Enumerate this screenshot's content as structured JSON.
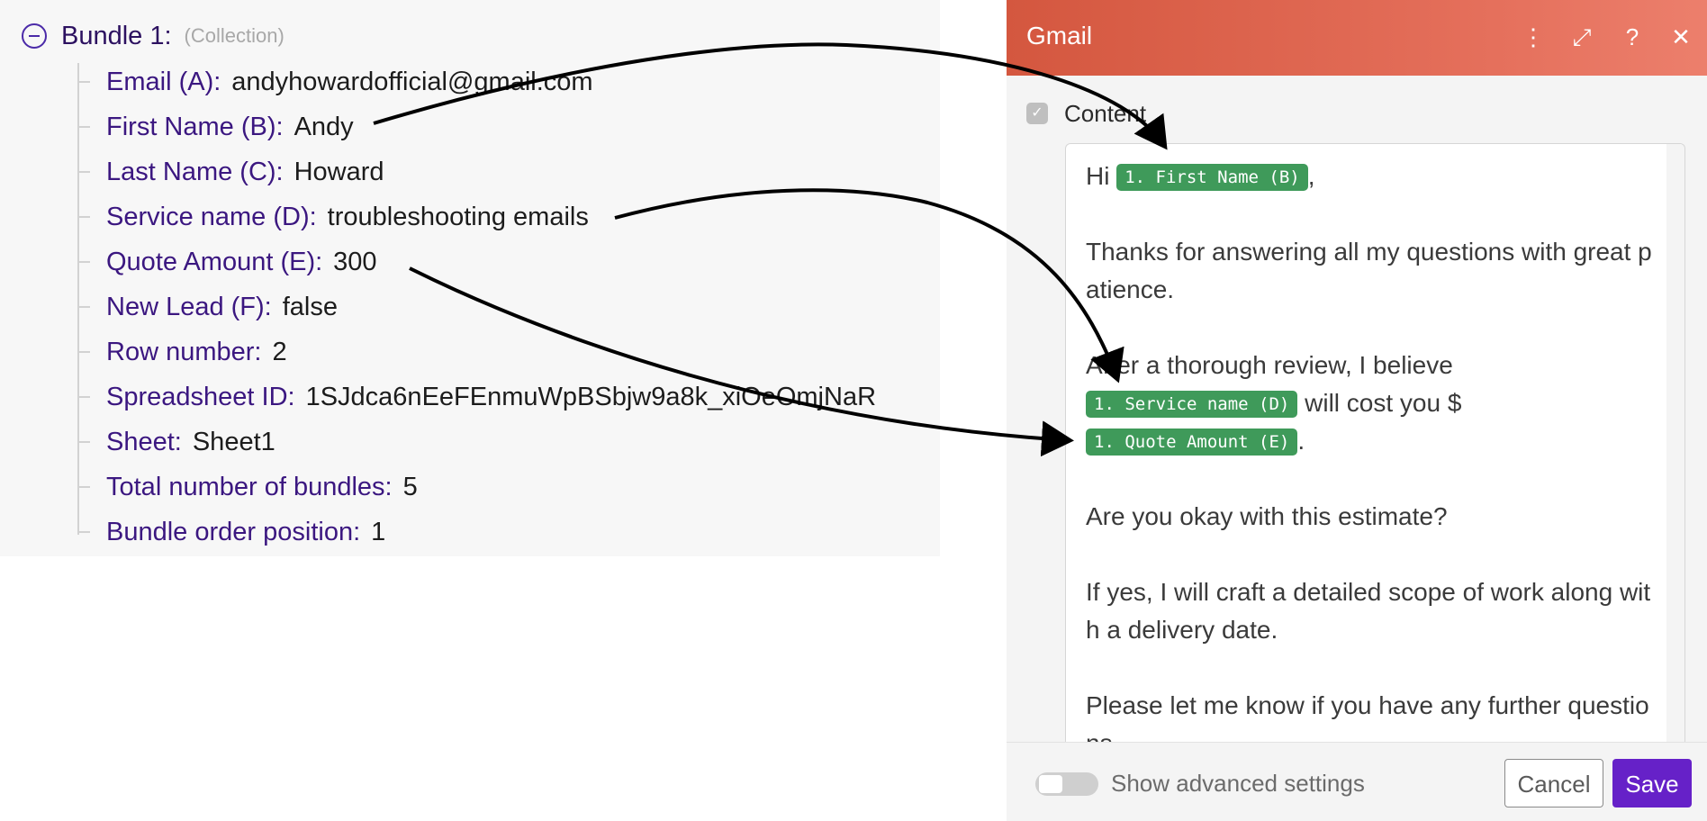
{
  "bundle": {
    "title": "Bundle 1:",
    "type": "(Collection)",
    "fields": [
      {
        "label": "Email (A):",
        "value": "andyhowardofficial@gmail.com"
      },
      {
        "label": "First Name (B):",
        "value": "Andy"
      },
      {
        "label": "Last Name (C):",
        "value": "Howard"
      },
      {
        "label": "Service name (D):",
        "value": "troubleshooting emails"
      },
      {
        "label": "Quote Amount (E):",
        "value": "300"
      },
      {
        "label": "New Lead (F):",
        "value": "false"
      },
      {
        "label": "Row number:",
        "value": "2"
      },
      {
        "label": "Spreadsheet ID:",
        "value": "1SJdca6nEeFEnmuWpBSbjw9a8k_xiOeOmjNaR"
      },
      {
        "label": "Sheet:",
        "value": "Sheet1"
      },
      {
        "label": "Total number of bundles:",
        "value": "5"
      },
      {
        "label": "Bundle order position:",
        "value": "1"
      }
    ]
  },
  "gmail": {
    "title": "Gmail",
    "icons": [
      "more-vertical-icon",
      "expand-icon",
      "help-icon",
      "close-icon"
    ],
    "icon_glyphs": {
      "more": "⋮",
      "expand": "⤢",
      "help": "?",
      "close": "✕"
    },
    "content_label": "Content",
    "check_glyph": "✓",
    "email": {
      "greeting": "Hi",
      "pill_first_name": "1. First Name (B)",
      "comma": ",",
      "line_thanks": "Thanks for answering all my questions with great patience.",
      "line_review": "After a thorough review, I believe",
      "pill_service": "1. Service name (D)",
      "line_cost": "will cost you $",
      "pill_quote": "1. Quote Amount (E)",
      "period": ".",
      "line_okay": "Are you okay with this estimate?",
      "line_scope": "If yes, I will craft a detailed scope of work along with a delivery date.",
      "line_further": "Please let me know if you have any further questions."
    },
    "footer": {
      "advanced_label": "Show advanced settings",
      "advanced_on": false,
      "cancel_label": "Cancel",
      "save_label": "Save"
    }
  },
  "colors": {
    "header_gradient_start": "#d4573f",
    "header_gradient_end": "#ec7f6c",
    "pill": "#3f9a5a",
    "save_button": "#6621c8",
    "field_label": "#3b1780"
  }
}
